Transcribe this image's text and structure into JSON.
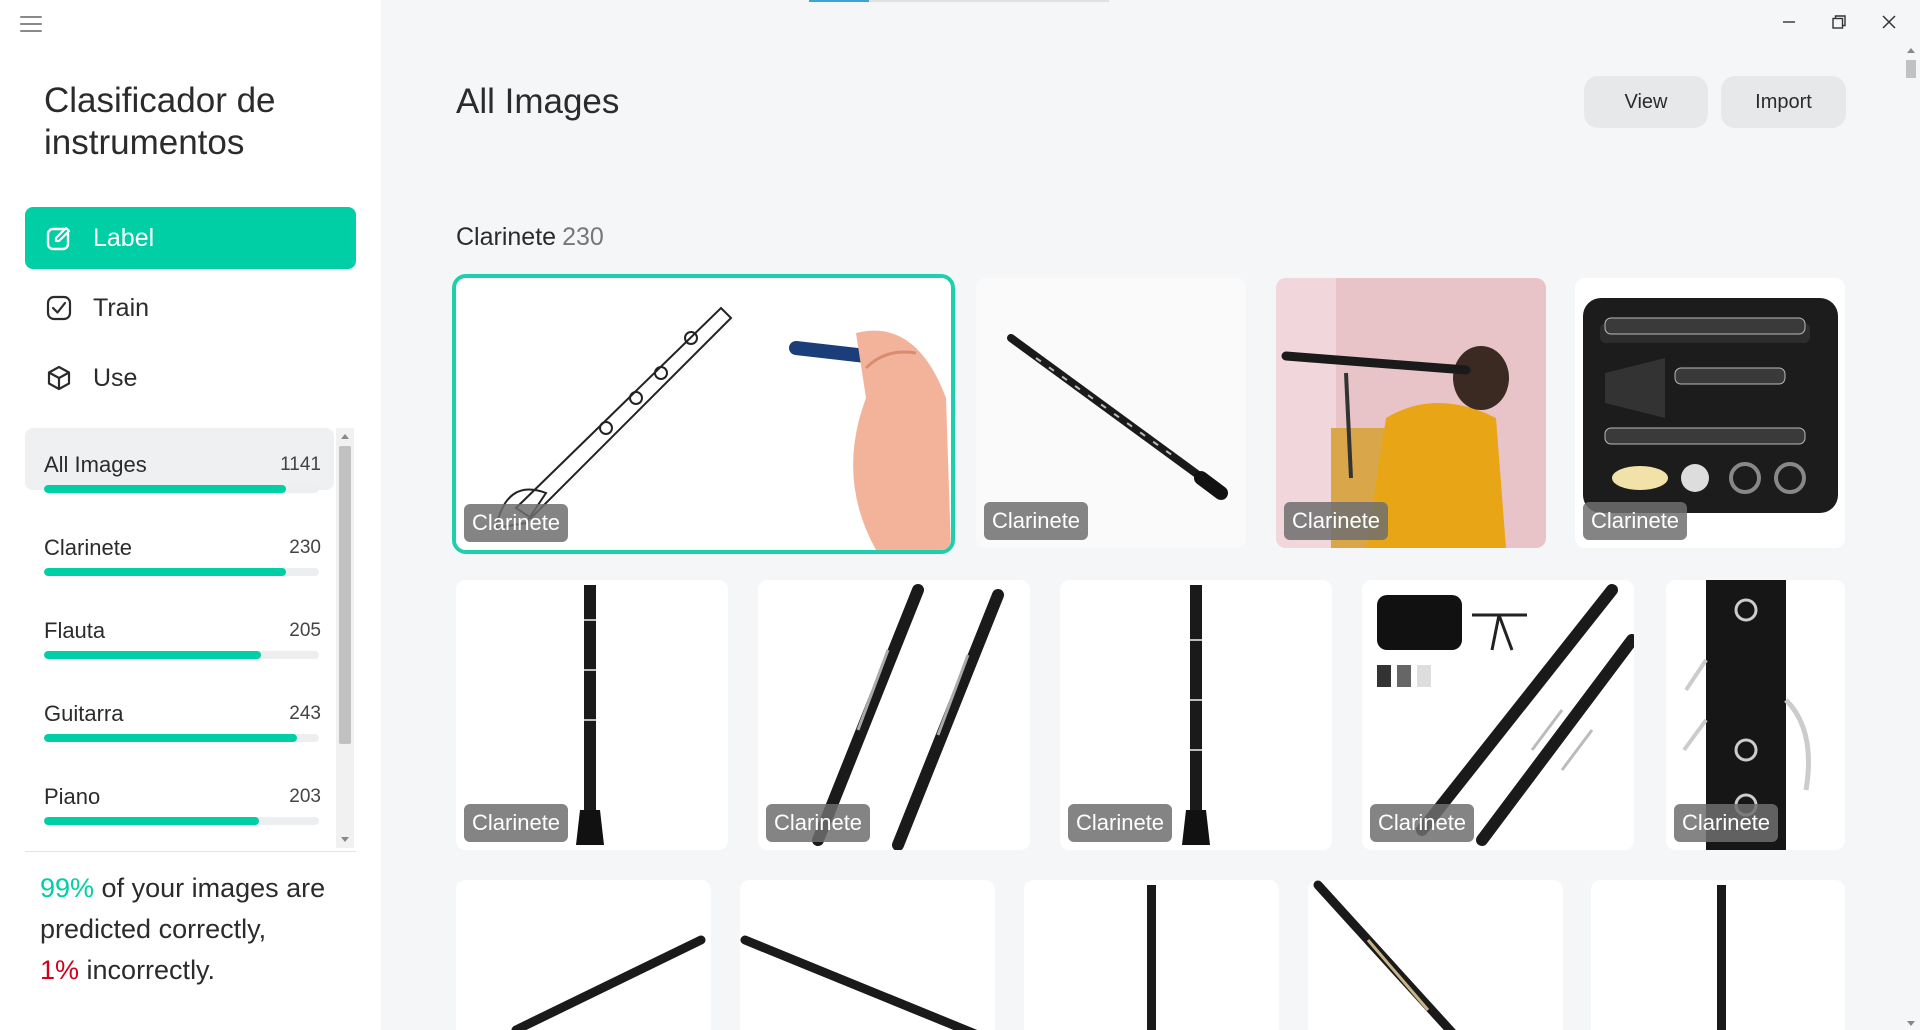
{
  "sidebar": {
    "title": "Clasificador de instrumentos",
    "nav": [
      {
        "label": "Label",
        "icon": "edit-icon",
        "active": true
      },
      {
        "label": "Train",
        "icon": "checkbox-icon",
        "active": false
      },
      {
        "label": "Use",
        "icon": "cube-icon",
        "active": false
      }
    ],
    "classes": [
      {
        "name": "All Images",
        "count": "1141",
        "progress": 0.88,
        "active": true
      },
      {
        "name": "Clarinete",
        "count": "230",
        "progress": 0.88,
        "active": false
      },
      {
        "name": "Flauta",
        "count": "205",
        "progress": 0.79,
        "active": false
      },
      {
        "name": "Guitarra",
        "count": "243",
        "progress": 0.92,
        "active": false
      },
      {
        "name": "Piano",
        "count": "203",
        "progress": 0.78,
        "active": false
      }
    ],
    "stats": {
      "correct_pct": "99%",
      "correct_text": " of your images are predicted correctly,",
      "incorrect_pct": "1%",
      "incorrect_text": " incorrectly."
    }
  },
  "main": {
    "title": "All Images",
    "view_label": "View",
    "import_label": "Import",
    "section": {
      "name": "Clarinete",
      "count": "230"
    },
    "tag_label": "Clarinete"
  },
  "colors": {
    "accent": "#00cfa6",
    "incorrect": "#d0021b"
  }
}
